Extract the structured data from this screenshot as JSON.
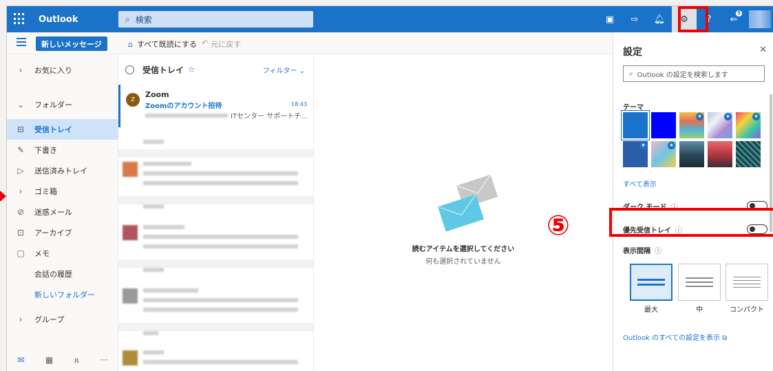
{
  "topbar": {
    "app_name": "Outlook",
    "search_placeholder": "検索",
    "notification_count": "5"
  },
  "commands": {
    "new_message": "新しいメッセージ",
    "mark_all_read": "すべて既読にする",
    "undo": "元に戻す"
  },
  "folders": {
    "favorites": "お気に入り",
    "folders": "フォルダー",
    "inbox": "受信トレイ",
    "drafts": "下書き",
    "sent": "送信済みトレイ",
    "deleted": "ゴミ箱",
    "junk": "迷惑メール",
    "archive": "アーカイブ",
    "notes": "メモ",
    "conversation_history": "会話の履歴",
    "new_folder": "新しいフォルダー",
    "groups": "グループ"
  },
  "message_list": {
    "title": "受信トレイ",
    "filter": "フィルター",
    "selected_message": {
      "avatar_letter": "Z",
      "sender": "Zoom",
      "subject": "Zoomのアカウント招待",
      "time": "18:43",
      "preview": "ITセンター サポートチ..."
    }
  },
  "reading_pane": {
    "empty_title": "読むアイテムを選択してください",
    "empty_subtitle": "何も選択されていません",
    "annotation": "⑤"
  },
  "settings": {
    "title": "設定",
    "search_placeholder": "Outlook の設定を検索します",
    "theme_label": "テーマ",
    "show_all": "すべて表示",
    "dark_mode": "ダーク モード",
    "focused_inbox": "優先受信トレイ",
    "display_density": "表示間隔",
    "density_options": [
      "最大",
      "中",
      "コンパクト"
    ],
    "all_settings_link": "Outlook のすべての設定を表示"
  },
  "colors": {
    "accent": "#1a73c8",
    "highlight_red": "#e00000"
  }
}
